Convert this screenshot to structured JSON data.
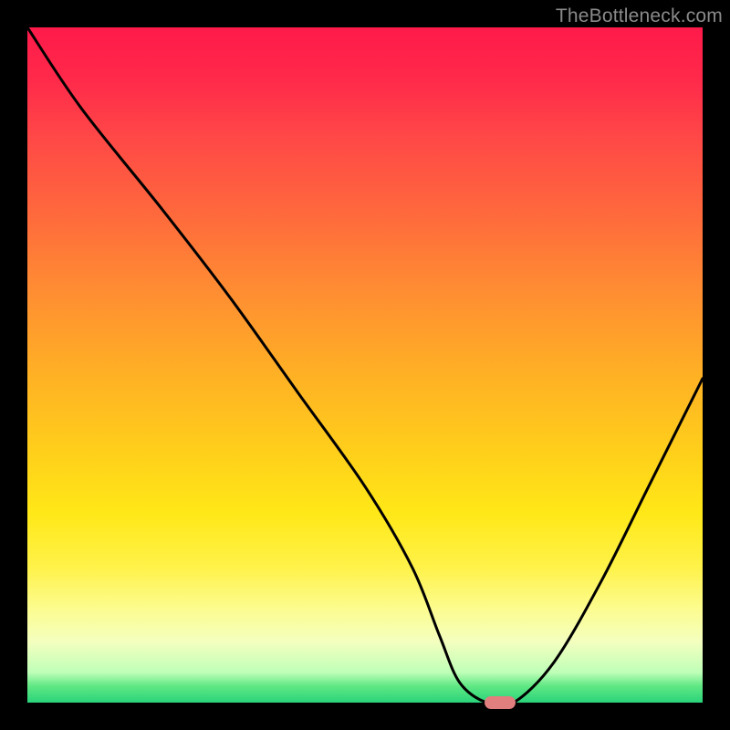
{
  "watermark": "TheBottleneck.com",
  "chart_data": {
    "type": "line",
    "title": "",
    "xlabel": "",
    "ylabel": "",
    "xlim": [
      0,
      100
    ],
    "ylim": [
      0,
      100
    ],
    "grid": false,
    "series": [
      {
        "name": "curve",
        "x": [
          0,
          8,
          20,
          30,
          40,
          50,
          57,
          61,
          64,
          68,
          72,
          78,
          85,
          92,
          100
        ],
        "y": [
          100,
          88,
          73,
          60,
          46,
          32,
          20,
          10,
          3,
          0,
          0,
          6,
          18,
          32,
          48
        ]
      }
    ],
    "marker": {
      "x": 70,
      "y": 0,
      "color": "#e17e7e"
    },
    "curve_color": "#000000",
    "curve_width": 3
  }
}
